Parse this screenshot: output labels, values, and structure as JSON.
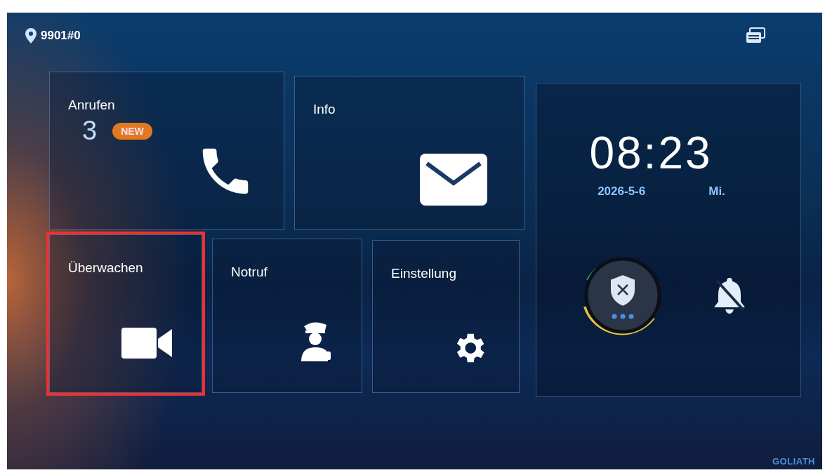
{
  "status_bar": {
    "location": "9901#0"
  },
  "tiles": [
    {
      "kind": "calls",
      "label": "Anrufen",
      "count": "3",
      "badge": "NEW",
      "highlighted": false
    },
    {
      "kind": "info",
      "label": "Info",
      "highlighted": false
    },
    {
      "kind": "monitor",
      "label": "Überwachen",
      "highlighted": true
    },
    {
      "kind": "emergency",
      "label": "Notruf",
      "highlighted": false
    },
    {
      "kind": "settings",
      "label": "Einstellung",
      "highlighted": false
    }
  ],
  "clock": {
    "time": "08:23",
    "date": "2026-5-6",
    "weekday": "Mi."
  },
  "brand": "GOLIATH"
}
